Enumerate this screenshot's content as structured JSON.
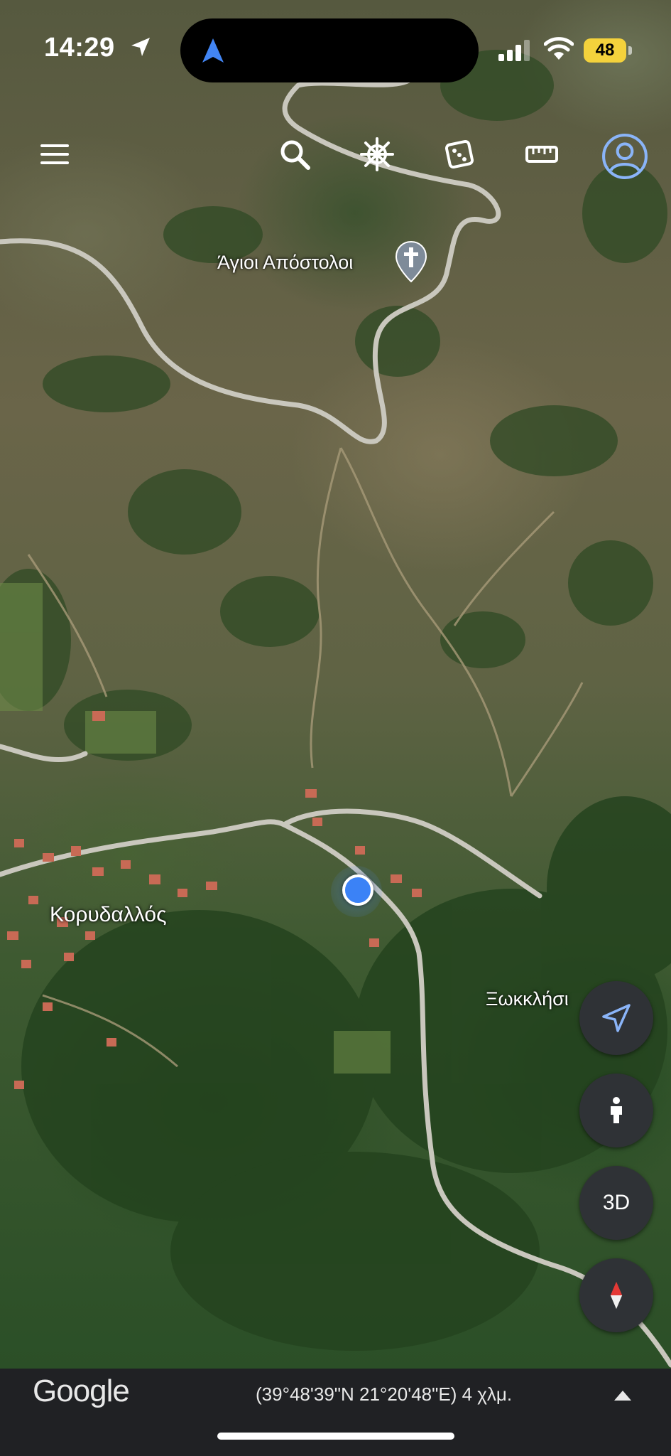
{
  "status_bar": {
    "time": "14:29",
    "battery": "48"
  },
  "toolbar": {
    "menu_icon": "hamburger-menu-icon",
    "search_icon": "search-icon",
    "voyager_icon": "ship-wheel-icon",
    "random_icon": "dice-icon",
    "measure_icon": "ruler-icon",
    "account_icon": "account-circle-icon"
  },
  "map": {
    "poi_church": "Άγιοι Απόστολοι",
    "village": "Κορυδαλλός",
    "poi_chapel": "Ξωκκλήσι"
  },
  "controls": {
    "locate_icon": "navigation-arrow-icon",
    "streetview_icon": "pegman-icon",
    "view_3d": "3D",
    "compass_icon": "compass-icon"
  },
  "bottom": {
    "logo": "Google",
    "coordinates": "(39°48'39\"N 21°20'48\"E) 4 χλμ."
  },
  "colors": {
    "accent": "#4285f4",
    "location_dot": "#3b82f6",
    "battery": "#f4d23c",
    "panel": "#202124"
  }
}
